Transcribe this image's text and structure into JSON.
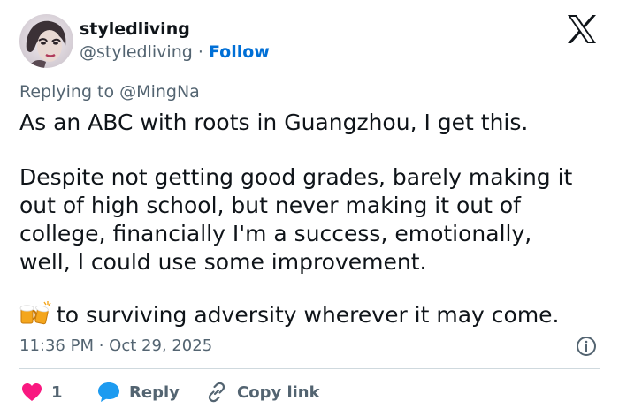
{
  "author": {
    "display_name": "styledliving",
    "handle": "@styledliving",
    "separator": "·",
    "follow_label": "Follow"
  },
  "reply_context": {
    "prefix": "Replying to",
    "mention": "@MingNa"
  },
  "tweet": {
    "lines": [
      "As an ABC with roots in Guangzhou, I get this.",
      "Despite not getting good grades, barely making it",
      "out of high school, but never making it out of",
      "college, financially I'm a success, emotionally,",
      "well, I could use some improvement.",
      "to surviving adversity wherever it may come."
    ],
    "emoji_icon": "clinking-beer-mugs-icon",
    "timestamp": "11:36 PM · Oct 29, 2025"
  },
  "actions": {
    "like_count": "1",
    "reply_label": "Reply",
    "copy_link_label": "Copy link"
  },
  "colors": {
    "text": "#0f1419",
    "secondary": "#536471",
    "link": "#006fd6",
    "like": "#f91880",
    "reply": "#1d9bf0",
    "divider": "#cfd9de"
  }
}
